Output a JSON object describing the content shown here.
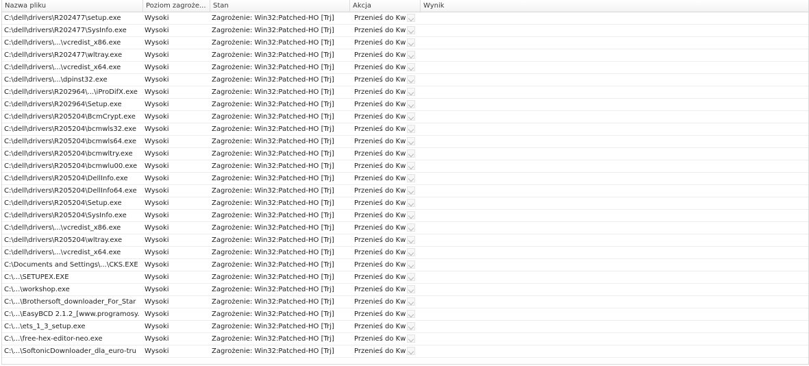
{
  "columns": [
    "Nazwa pliku",
    "Poziom zagroże...",
    "Stan",
    "Akcja",
    "Wynik"
  ],
  "rows": [
    {
      "file": "C:\\dell\\drivers\\R202477\\setup.exe",
      "level": "Wysoki",
      "status": "Zagrożenie: Win32:Patched-HO [Trj]",
      "action": "Przenieś do Kw",
      "result": ""
    },
    {
      "file": "C:\\dell\\drivers\\R202477\\SysInfo.exe",
      "level": "Wysoki",
      "status": "Zagrożenie: Win32:Patched-HO [Trj]",
      "action": "Przenieś do Kw",
      "result": ""
    },
    {
      "file": "C:\\dell\\drivers\\...\\vcredist_x86.exe",
      "level": "Wysoki",
      "status": "Zagrożenie: Win32:Patched-HO [Trj]",
      "action": "Przenieś do Kw",
      "result": ""
    },
    {
      "file": "C:\\dell\\drivers\\R202477\\wltray.exe",
      "level": "Wysoki",
      "status": "Zagrożenie: Win32:Patched-HO [Trj]",
      "action": "Przenieś do Kw",
      "result": ""
    },
    {
      "file": "C:\\dell\\drivers\\...\\vcredist_x64.exe",
      "level": "Wysoki",
      "status": "Zagrożenie: Win32:Patched-HO [Trj]",
      "action": "Przenieś do Kw",
      "result": ""
    },
    {
      "file": "C:\\dell\\drivers\\...\\dpinst32.exe",
      "level": "Wysoki",
      "status": "Zagrożenie: Win32:Patched-HO [Trj]",
      "action": "Przenieś do Kw",
      "result": ""
    },
    {
      "file": "C:\\dell\\drivers\\R202964\\...\\iProDifX.exe",
      "level": "Wysoki",
      "status": "Zagrożenie: Win32:Patched-HO [Trj]",
      "action": "Przenieś do Kw",
      "result": ""
    },
    {
      "file": "C:\\dell\\drivers\\R202964\\Setup.exe",
      "level": "Wysoki",
      "status": "Zagrożenie: Win32:Patched-HO [Trj]",
      "action": "Przenieś do Kw",
      "result": ""
    },
    {
      "file": "C:\\dell\\drivers\\R205204\\BcmCrypt.exe",
      "level": "Wysoki",
      "status": "Zagrożenie: Win32:Patched-HO [Trj]",
      "action": "Przenieś do Kw",
      "result": ""
    },
    {
      "file": "C:\\dell\\drivers\\R205204\\bcmwls32.exe",
      "level": "Wysoki",
      "status": "Zagrożenie: Win32:Patched-HO [Trj]",
      "action": "Przenieś do Kw",
      "result": ""
    },
    {
      "file": "C:\\dell\\drivers\\R205204\\bcmwls64.exe",
      "level": "Wysoki",
      "status": "Zagrożenie: Win32:Patched-HO [Trj]",
      "action": "Przenieś do Kw",
      "result": ""
    },
    {
      "file": "C:\\dell\\drivers\\R205204\\bcmwltry.exe",
      "level": "Wysoki",
      "status": "Zagrożenie: Win32:Patched-HO [Trj]",
      "action": "Przenieś do Kw",
      "result": ""
    },
    {
      "file": "C:\\dell\\drivers\\R205204\\bcmwlu00.exe",
      "level": "Wysoki",
      "status": "Zagrożenie: Win32:Patched-HO [Trj]",
      "action": "Przenieś do Kw",
      "result": ""
    },
    {
      "file": "C:\\dell\\drivers\\R205204\\DellInfo.exe",
      "level": "Wysoki",
      "status": "Zagrożenie: Win32:Patched-HO [Trj]",
      "action": "Przenieś do Kw",
      "result": ""
    },
    {
      "file": "C:\\dell\\drivers\\R205204\\DellInfo64.exe",
      "level": "Wysoki",
      "status": "Zagrożenie: Win32:Patched-HO [Trj]",
      "action": "Przenieś do Kw",
      "result": ""
    },
    {
      "file": "C:\\dell\\drivers\\R205204\\Setup.exe",
      "level": "Wysoki",
      "status": "Zagrożenie: Win32:Patched-HO [Trj]",
      "action": "Przenieś do Kw",
      "result": ""
    },
    {
      "file": "C:\\dell\\drivers\\R205204\\SysInfo.exe",
      "level": "Wysoki",
      "status": "Zagrożenie: Win32:Patched-HO [Trj]",
      "action": "Przenieś do Kw",
      "result": ""
    },
    {
      "file": "C:\\dell\\drivers\\...\\vcredist_x86.exe",
      "level": "Wysoki",
      "status": "Zagrożenie: Win32:Patched-HO [Trj]",
      "action": "Przenieś do Kw",
      "result": ""
    },
    {
      "file": "C:\\dell\\drivers\\R205204\\wltray.exe",
      "level": "Wysoki",
      "status": "Zagrożenie: Win32:Patched-HO [Trj]",
      "action": "Przenieś do Kw",
      "result": ""
    },
    {
      "file": "C:\\dell\\drivers\\...\\vcredist_x64.exe",
      "level": "Wysoki",
      "status": "Zagrożenie: Win32:Patched-HO [Trj]",
      "action": "Przenieś do Kw",
      "result": ""
    },
    {
      "file": "C:\\Documents and Settings\\...\\CKS.EXE",
      "level": "Wysoki",
      "status": "Zagrożenie: Win32:Patched-HO [Trj]",
      "action": "Przenieś do Kw",
      "result": ""
    },
    {
      "file": "C:\\...\\SETUPEX.EXE",
      "level": "Wysoki",
      "status": "Zagrożenie: Win32:Patched-HO [Trj]",
      "action": "Przenieś do Kw",
      "result": ""
    },
    {
      "file": "C:\\...\\workshop.exe",
      "level": "Wysoki",
      "status": "Zagrożenie: Win32:Patched-HO [Trj]",
      "action": "Przenieś do Kw",
      "result": ""
    },
    {
      "file": "C:\\...\\Brothersoft_downloader_For_Star",
      "level": "Wysoki",
      "status": "Zagrożenie: Win32:Patched-HO [Trj]",
      "action": "Przenieś do Kw",
      "result": ""
    },
    {
      "file": "C:\\...\\EasyBCD 2.1.2_[www.programosy.",
      "level": "Wysoki",
      "status": "Zagrożenie: Win32:Patched-HO [Trj]",
      "action": "Przenieś do Kw",
      "result": ""
    },
    {
      "file": "C:\\...\\ets_1_3_setup.exe",
      "level": "Wysoki",
      "status": "Zagrożenie: Win32:Patched-HO [Trj]",
      "action": "Przenieś do Kw",
      "result": ""
    },
    {
      "file": "C:\\...\\free-hex-editor-neo.exe",
      "level": "Wysoki",
      "status": "Zagrożenie: Win32:Patched-HO [Trj]",
      "action": "Przenieś do Kw",
      "result": ""
    },
    {
      "file": "C:\\...\\SoftonicDownloader_dla_euro-tru",
      "level": "Wysoki",
      "status": "Zagrożenie: Win32:Patched-HO [Trj]",
      "action": "Przenieś do Kw",
      "result": ""
    }
  ]
}
